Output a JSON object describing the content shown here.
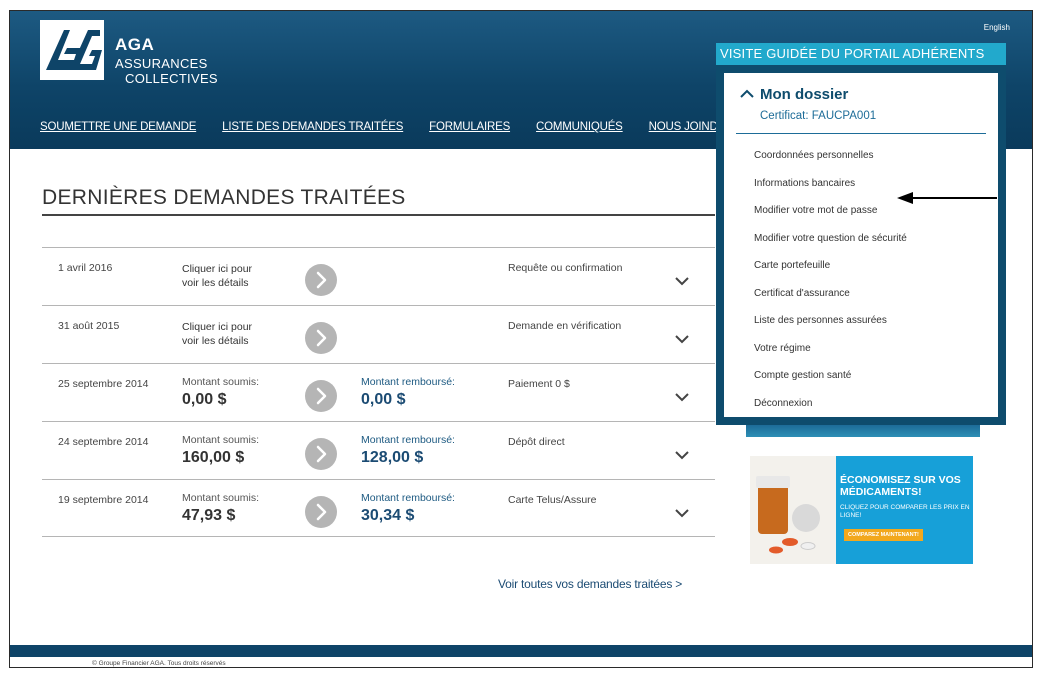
{
  "header": {
    "language_link": "English",
    "brand": {
      "name": "AGA",
      "line1": "ASSURANCES",
      "line2": "COLLECTIVES"
    },
    "tour_button": "VISITE GUIDÉE DU PORTAIL ADHÉRENTS >>>"
  },
  "nav": [
    {
      "label": "SOUMETTRE UNE DEMANDE"
    },
    {
      "label": "LISTE DES DEMANDES TRAITÉES"
    },
    {
      "label": "FORMULAIRES"
    },
    {
      "label": "COMMUNIQUÉS"
    },
    {
      "label": "NOUS JOINDRE"
    }
  ],
  "main": {
    "title": "DERNIÈRES DEMANDES TRAITÉES",
    "see_all": "Voir toutes vos demandes traitées >",
    "claims": [
      {
        "date": "1 avril 2016",
        "link_line1": "Cliquer ici pour",
        "link_line2": "voir les détails",
        "status": "Requête ou confirmation"
      },
      {
        "date": "31 août 2015",
        "link_line1": "Cliquer ici pour",
        "link_line2": "voir les détails",
        "status": "Demande en vérification"
      },
      {
        "date": "25 septembre 2014",
        "submitted_label": "Montant soumis:",
        "submitted": "0,00 $",
        "reimbursed_label": "Montant remboursé:",
        "reimbursed": "0,00 $",
        "status": "Paiement 0 $"
      },
      {
        "date": "24 septembre 2014",
        "submitted_label": "Montant soumis:",
        "submitted": "160,00 $",
        "reimbursed_label": "Montant remboursé:",
        "reimbursed": "128,00 $",
        "status": "Dépôt direct"
      },
      {
        "date": "19 septembre 2014",
        "submitted_label": "Montant soumis:",
        "submitted": "47,93 $",
        "reimbursed_label": "Montant remboursé:",
        "reimbursed": "30,34 $",
        "status": "Carte Telus/Assure"
      }
    ]
  },
  "dossier": {
    "title": "Mon dossier",
    "certificate": "Certificat: FAUCPA001",
    "menu": [
      "Coordonnées personnelles",
      "Informations bancaires",
      "Modifier votre mot de passe",
      "Modifier votre question de sécurité",
      "Carte portefeuille",
      "Certificat d'assurance",
      "Liste des personnes assurées",
      "Votre régime",
      "Compte gestion santé",
      "Déconnexion"
    ]
  },
  "ad": {
    "headline": "ÉCONOMISEZ SUR VOS MÉDICAMENTS!",
    "subline": "CLIQUEZ POUR COMPARER LES PRIX EN LIGNE!",
    "button": "COMPAREZ MAINTENANT!"
  },
  "footer": {
    "copyright": "© Groupe Financier AGA. Tous droits réservés"
  },
  "colors": {
    "header_blue": "#0e4468",
    "tour_cyan": "#22a9cc",
    "panel_blue": "#0e4c6d",
    "ad_blue": "#17a0d8",
    "ad_orange": "#f2a81d"
  }
}
